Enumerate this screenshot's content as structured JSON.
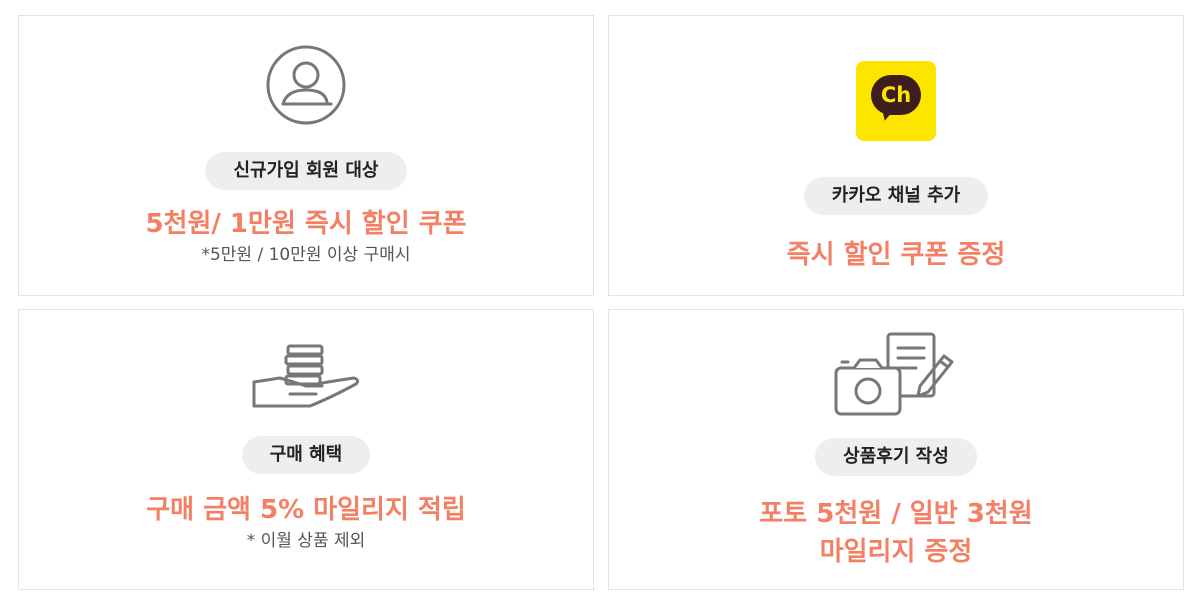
{
  "cards": [
    {
      "icon": "user-icon",
      "label": "신규가입 회원 대상",
      "main_lines": [
        "5천원/ 1만원 즉시 할인 쿠폰"
      ],
      "note": "*5만원 / 10만원 이상 구매시"
    },
    {
      "icon": "kakao-channel-icon",
      "icon_text": "Ch",
      "label": "카카오 채널 추가",
      "main_lines": [
        "즉시 할인 쿠폰 증정"
      ],
      "note": ""
    },
    {
      "icon": "coins-hand-icon",
      "label": "구매 혜택",
      "main_lines": [
        "구매 금액 5% 마일리지 적립"
      ],
      "note": "* 이월 상품 제외"
    },
    {
      "icon": "camera-review-icon",
      "label": "상품후기 작성",
      "main_lines": [
        "포토 5천원 / 일반 3천원",
        "마일리지 증정"
      ],
      "note": ""
    }
  ],
  "colors": {
    "accent": "#f37f64",
    "pill_bg": "#eeeeee",
    "border": "#e3e3e3",
    "icon_stroke": "#777777",
    "kakao_yellow": "#fee500",
    "kakao_dark": "#3c1e1e"
  }
}
